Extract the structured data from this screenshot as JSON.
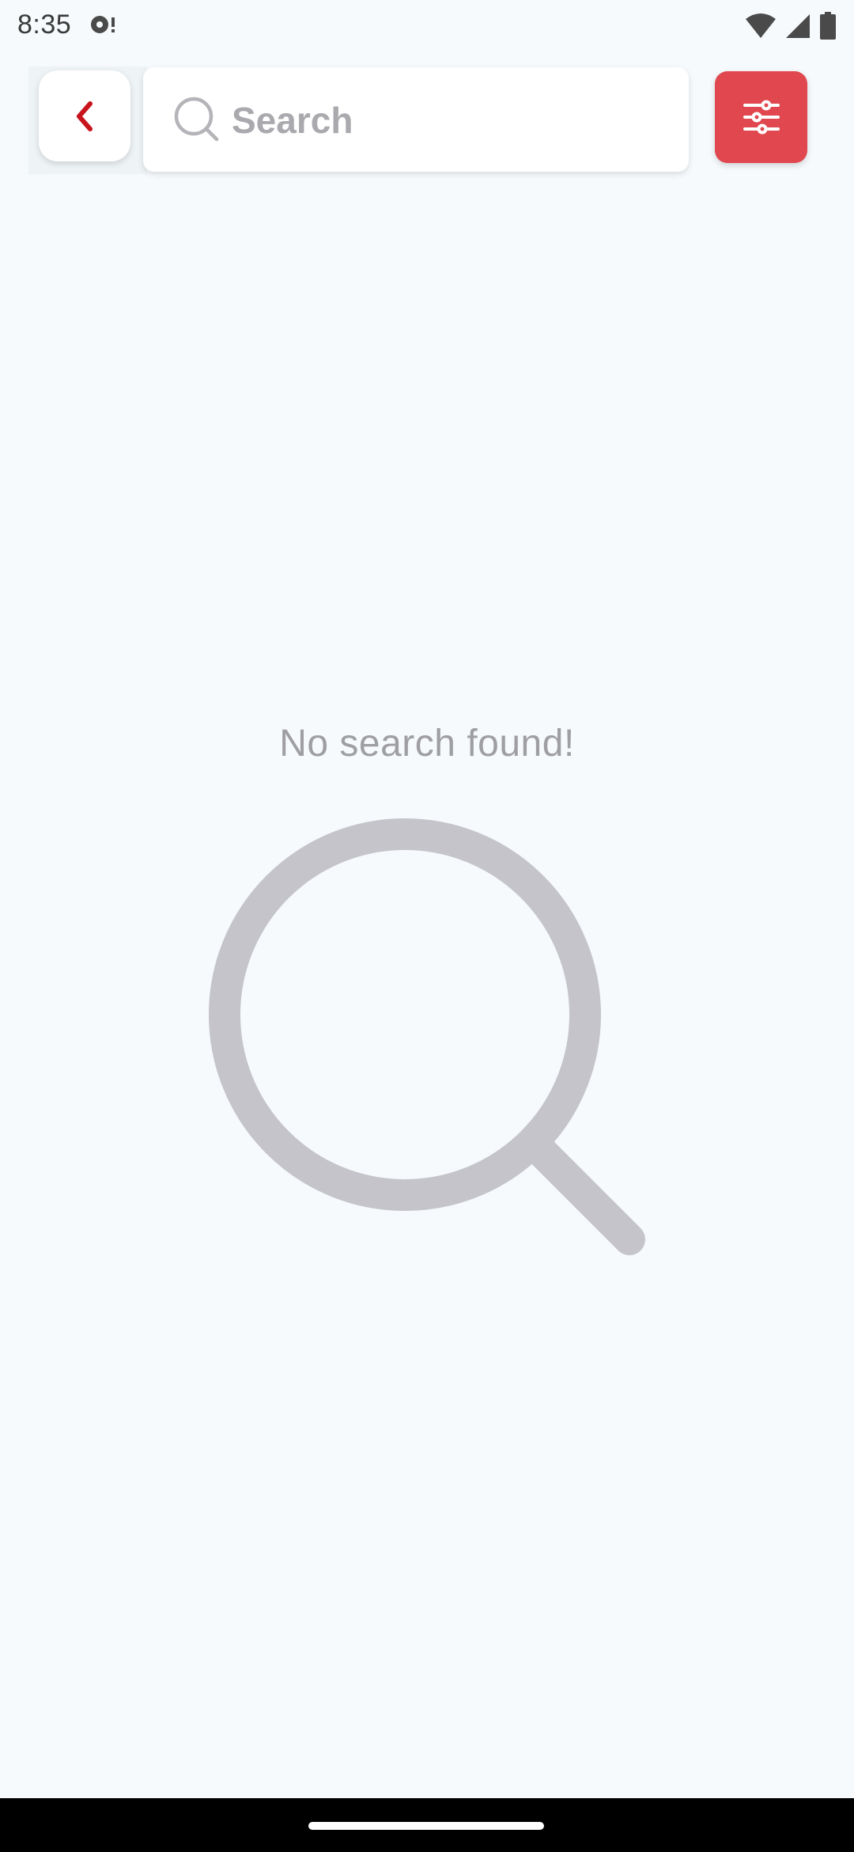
{
  "status_bar": {
    "time": "8:35",
    "icons": [
      "app-notification-icon",
      "wifi-icon",
      "cellular-signal-icon",
      "battery-icon"
    ]
  },
  "header": {
    "back_icon": "chevron-left-icon",
    "search": {
      "placeholder": "Search",
      "value": "",
      "icon": "search-icon"
    },
    "filter_icon": "sliders-icon"
  },
  "empty_state": {
    "message": "No search found!",
    "icon": "magnifier-icon"
  },
  "colors": {
    "background": "#F6FAFC",
    "accent": "#E0474E",
    "back_chevron": "#C8141C",
    "muted_text": "#9E9EA3",
    "illustration": "#C4C4CA"
  }
}
